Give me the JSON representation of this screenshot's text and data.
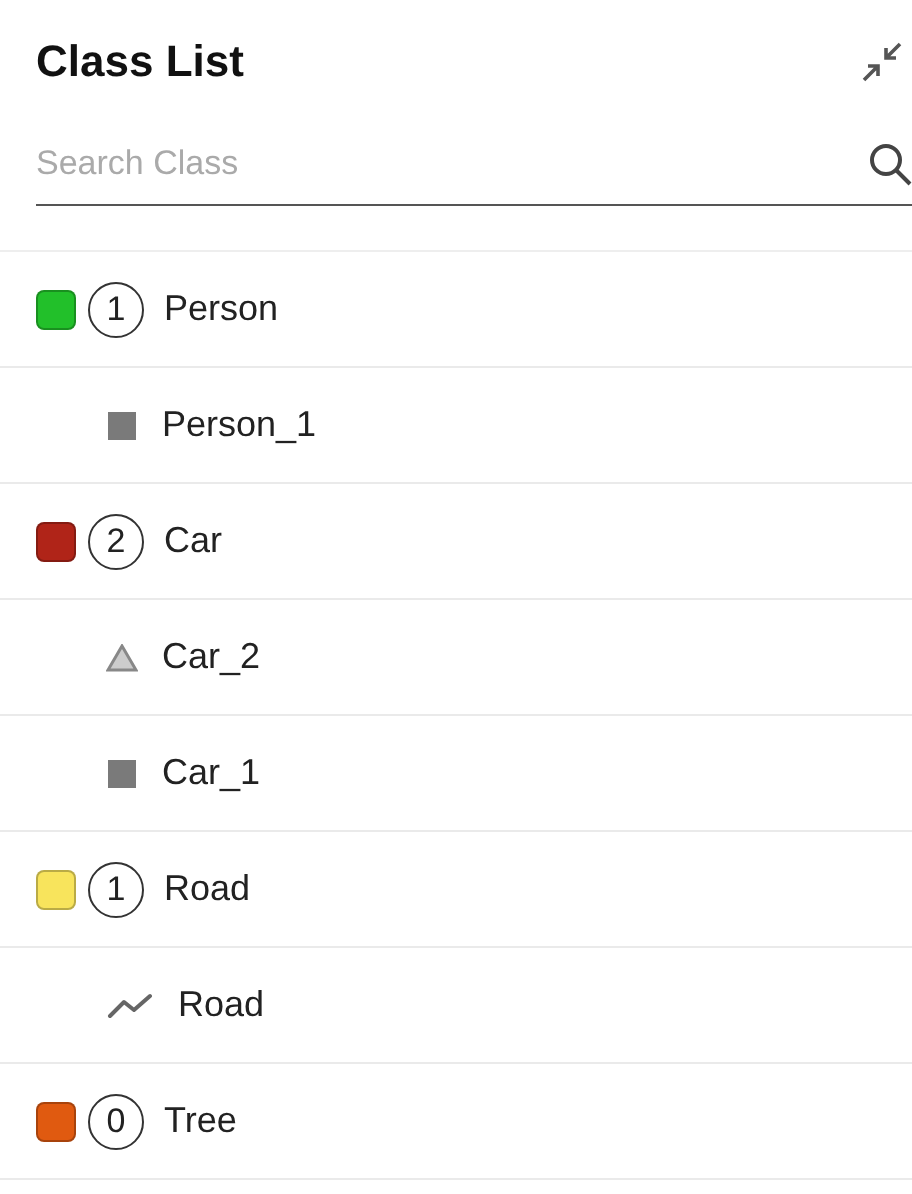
{
  "title": "Class List",
  "search": {
    "placeholder": "Search Class"
  },
  "classes": [
    {
      "name": "Person",
      "count": "1",
      "color": "#22c02a",
      "children": [
        {
          "name": "Person_1",
          "kind": "rect"
        }
      ]
    },
    {
      "name": "Car",
      "count": "2",
      "color": "#b02418",
      "children": [
        {
          "name": "Car_2",
          "kind": "polygon"
        },
        {
          "name": "Car_1",
          "kind": "rect"
        }
      ]
    },
    {
      "name": "Road",
      "count": "1",
      "color": "#f8e45c",
      "children": [
        {
          "name": "Road",
          "kind": "polyline"
        }
      ]
    },
    {
      "name": "Tree",
      "count": "0",
      "color": "#e05a10"
    }
  ]
}
